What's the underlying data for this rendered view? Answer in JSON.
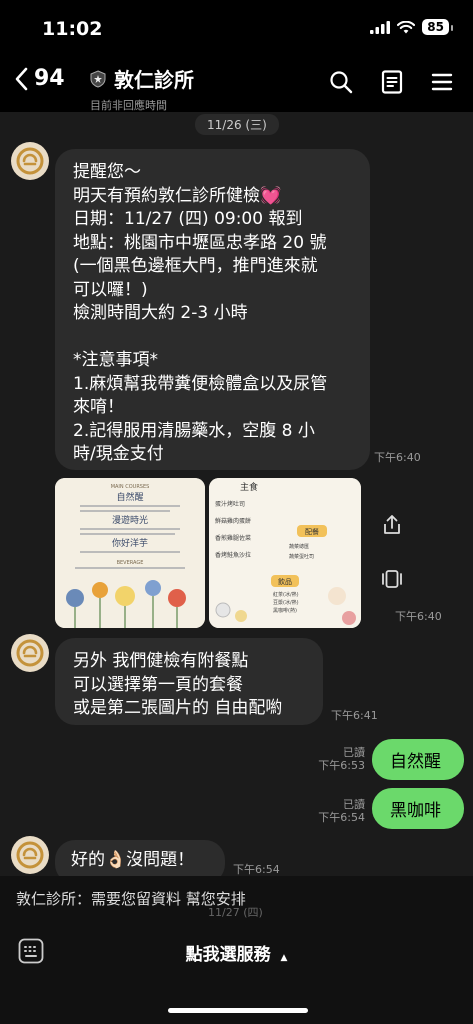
{
  "status_bar": {
    "time": "11:02",
    "battery": "85"
  },
  "header": {
    "back_count": "94",
    "title": "敦仁診所",
    "subtitle": "目前非回應時間"
  },
  "chat": {
    "date_divider": "11/26 (三)",
    "messages": [
      {
        "type": "incoming",
        "text": "提醒您～\n明天有預約敦仁診所健檢💓\n日期：11/27 (四) 09:00 報到\n地點：桃園市中壢區忠孝路 20 號\n(一個黑色邊框大門，推門進來就\n可以囉！)\n檢測時間大約 2-3 小時\n\n*注意事項*\n1.麻煩幫我帶糞便檢體盒以及尿管\n來唷！\n2.記得服用清腸藥水，空腹 8 小\n時/現金支付",
        "time": "下午6:40"
      },
      {
        "type": "images",
        "time": "下午6:40",
        "image1": {
          "subtitle": "MAIN COURSES",
          "sections": [
            "自然醒",
            "漫遊時光",
            "你好洋芋"
          ],
          "footer": "BEVERAGE"
        },
        "image2": {
          "sections": [
            "主食",
            "配餐",
            "飲品"
          ],
          "items": [
            "蛋汁烤吐司",
            "鮮菇雞肉蛋餅",
            "香煎雞腿佐菜",
            "香烤鮭魚沙拉",
            "蔬菜總匯",
            "蔬菜蛋吐司",
            "紅茶(冰/熱)",
            "豆漿(冰/熱)",
            "黑咖啡(熱)"
          ]
        }
      },
      {
        "type": "incoming",
        "text": "另外 我們健檢有附餐點\n可以選擇第一頁的套餐\n或是第二張圖片的 自由配喲",
        "time": "下午6:41"
      },
      {
        "type": "outgoing",
        "text": "自然醒",
        "read": "已讀",
        "time": "下午6:53"
      },
      {
        "type": "outgoing",
        "text": "黑咖啡",
        "read": "已讀",
        "time": "下午6:54"
      },
      {
        "type": "incoming",
        "text": "好的👌🏻沒問題！",
        "time": "下午6:54"
      }
    ]
  },
  "bottom": {
    "notice": "敦仁診所：需要您留資料 幫您安排",
    "ghost_date": "11/27 (四)",
    "service_button": "點我選服務",
    "service_arrow": "▲"
  },
  "icons": {
    "back": "chevron-left-icon",
    "shield": "shield-icon",
    "search": "search-icon",
    "notes": "note-icon",
    "menu": "menu-icon",
    "share": "share-icon",
    "carousel": "carousel-icon",
    "keyboard": "keyboard-icon",
    "avatar_logo": "clinic-logo-icon"
  },
  "colors": {
    "background": "#000000",
    "chat_background": "#1b1b1b",
    "incoming_bubble": "#2c2c2c",
    "outgoing_bubble": "#6bd96b"
  }
}
